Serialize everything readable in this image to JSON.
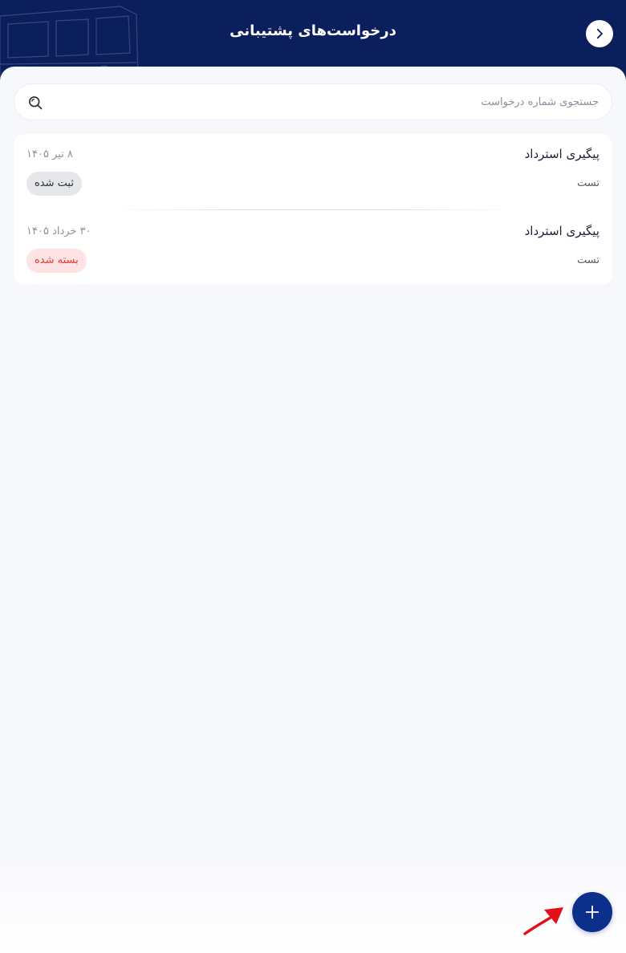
{
  "header": {
    "title": "درخواست‌های پشتیبانی",
    "back_icon": "chevron-right-icon",
    "background_color": "#0b1f5c"
  },
  "search": {
    "placeholder": "جستجوی شماره درخواست",
    "value": "",
    "icon": "search-icon"
  },
  "requests": [
    {
      "title": "پیگیری استرداد",
      "description": "تست",
      "date": "۸ تیر ۱۴۰۵",
      "status": "ثبت شده",
      "status_color": "#2b2f3a",
      "status_bg": "#e6e7ea"
    },
    {
      "title": "پیگیری استرداد",
      "description": "تست",
      "date": "۳۰ خرداد ۱۴۰۵",
      "status": "بسته شده",
      "status_color": "#e53935",
      "status_bg": "#fde3e3"
    }
  ],
  "fab": {
    "icon": "plus-icon",
    "color": "#0b2f8a"
  },
  "annotation": {
    "icon": "red-arrow-icon",
    "color": "#e3101a"
  }
}
